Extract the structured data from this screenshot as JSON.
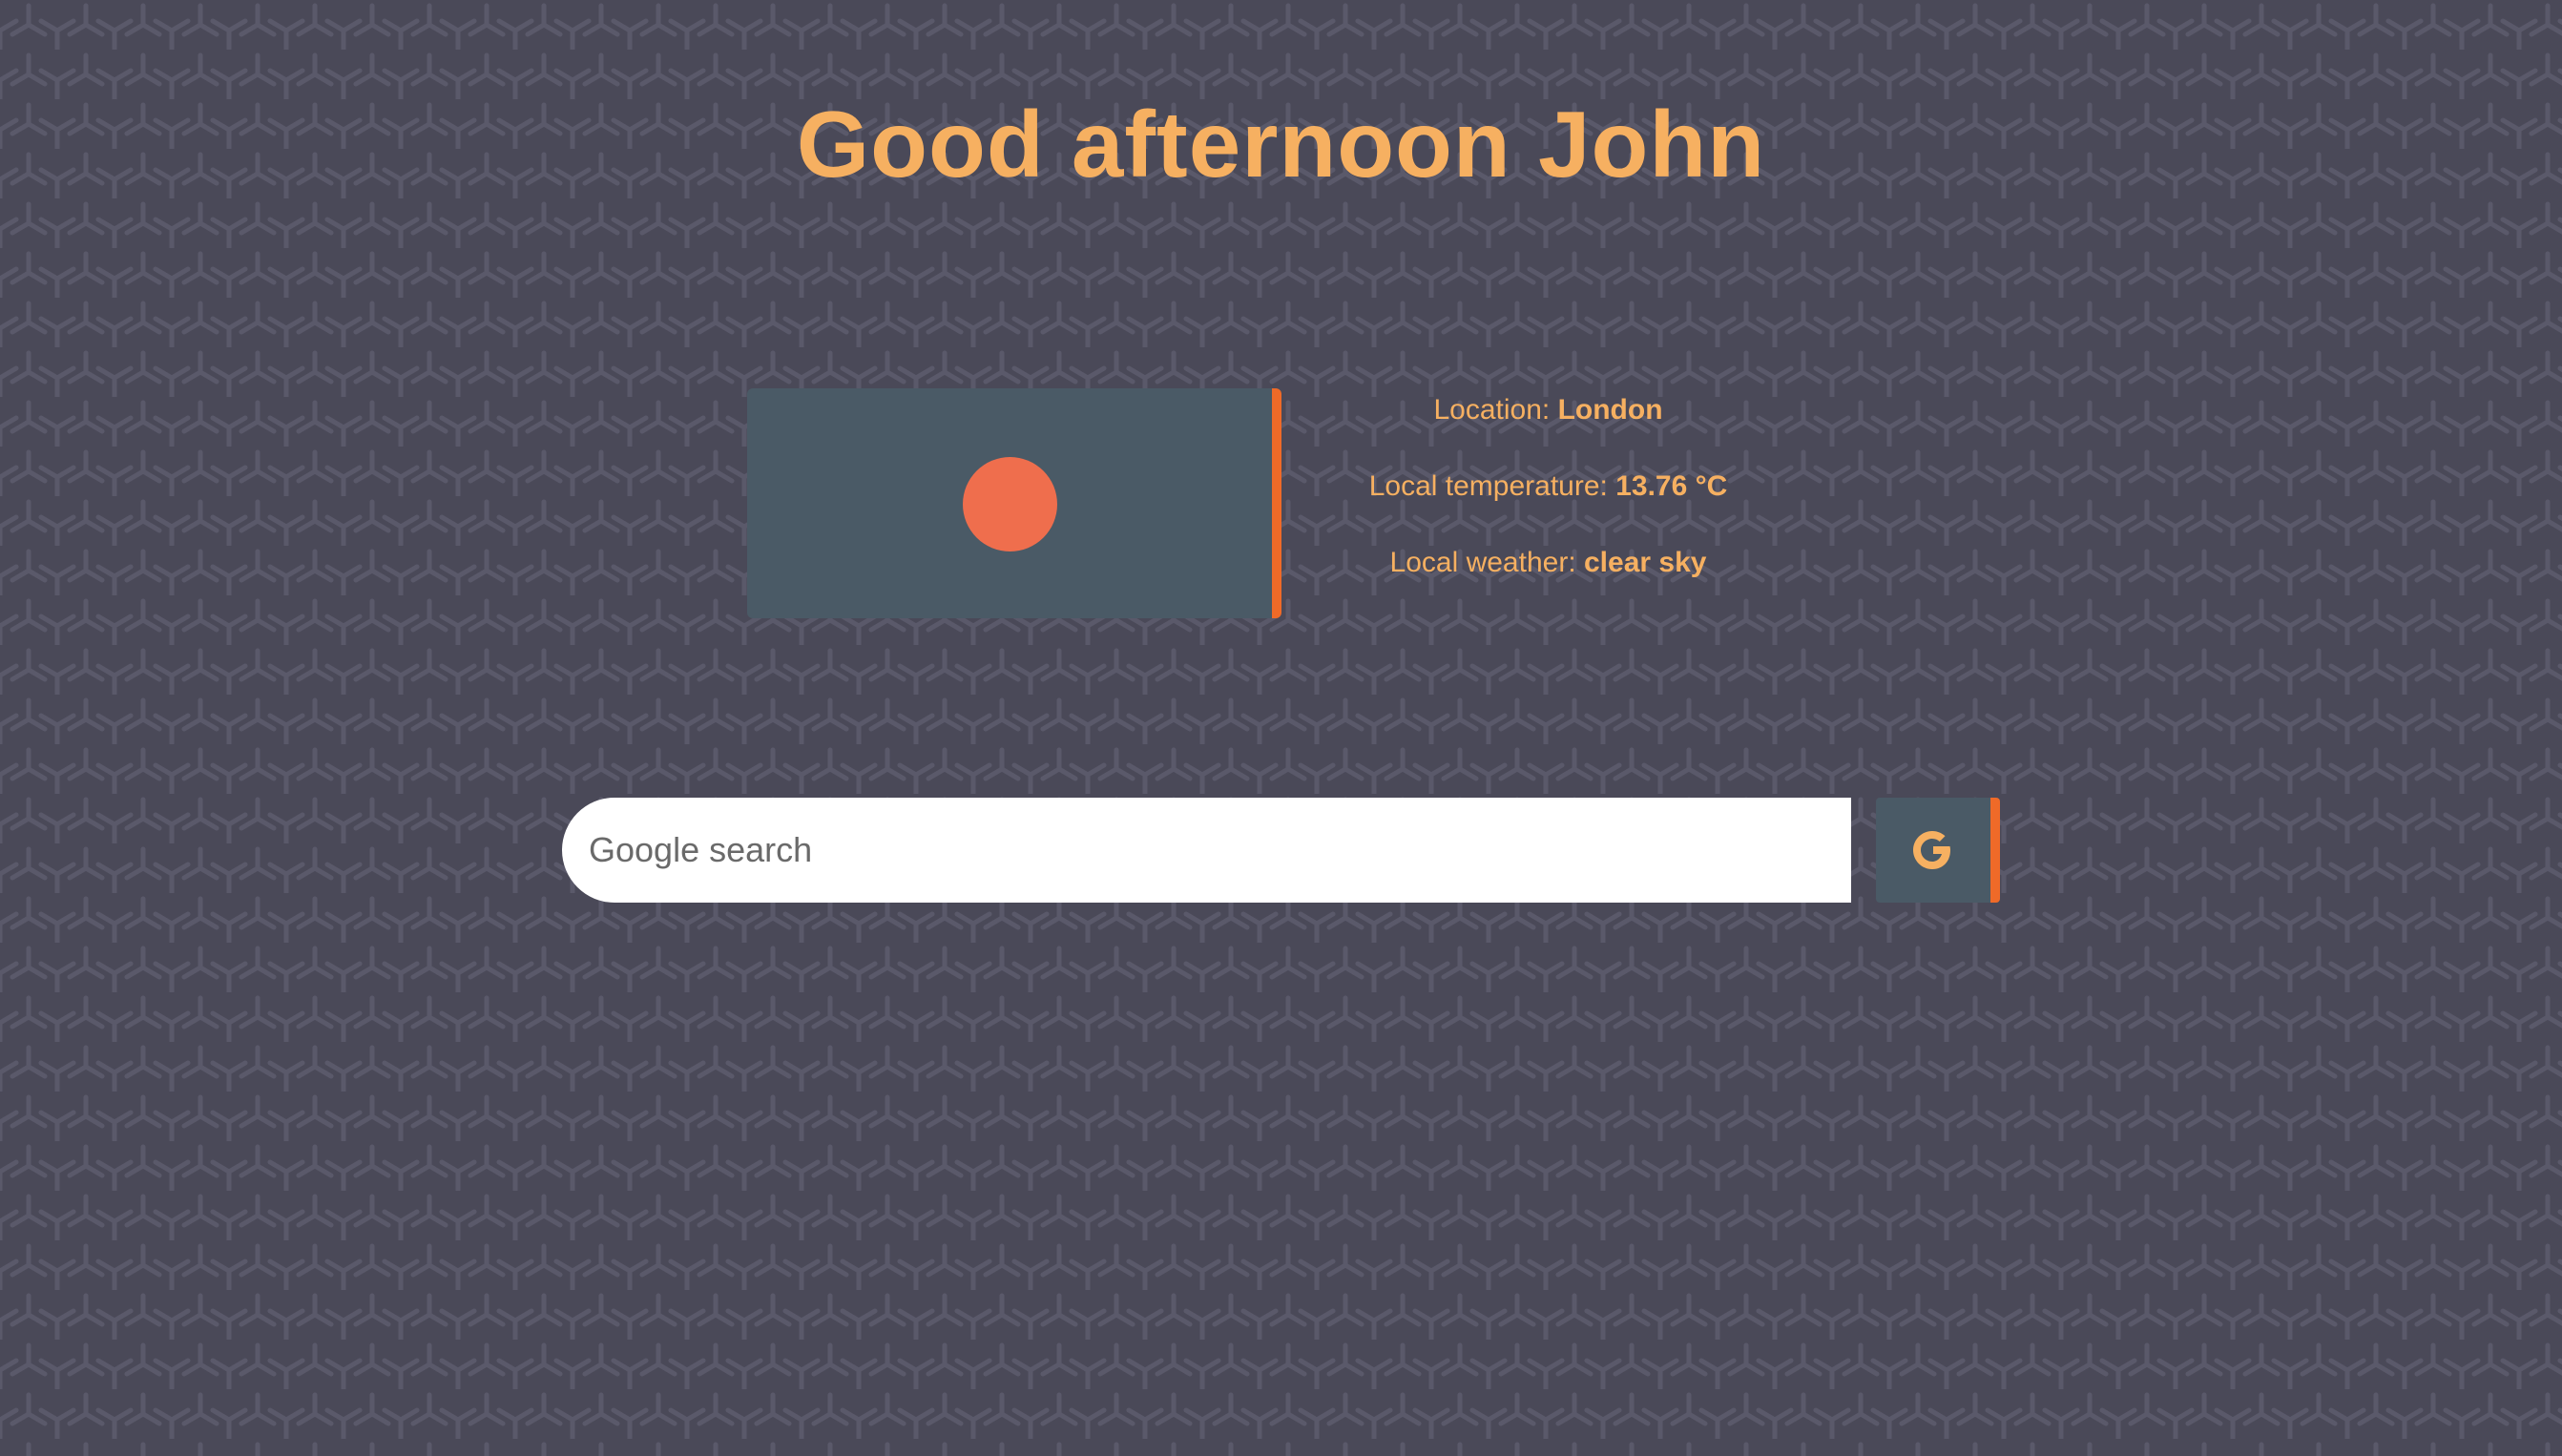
{
  "greeting": "Good afternoon John",
  "weather": {
    "icon": "sun-icon",
    "location_label": "Location:",
    "location_value": "London",
    "temperature_label": "Local temperature:",
    "temperature_value": "13.76 °C",
    "weather_label": "Local weather:",
    "weather_value": "clear sky"
  },
  "search": {
    "placeholder": "Google search",
    "value": "",
    "button_icon": "google-g-icon"
  },
  "colors": {
    "background": "#4a4958",
    "accent_text": "#f6b061",
    "accent_bar": "#ef6a28",
    "card": "#4a5a66",
    "sun": "#ef6e4d"
  }
}
